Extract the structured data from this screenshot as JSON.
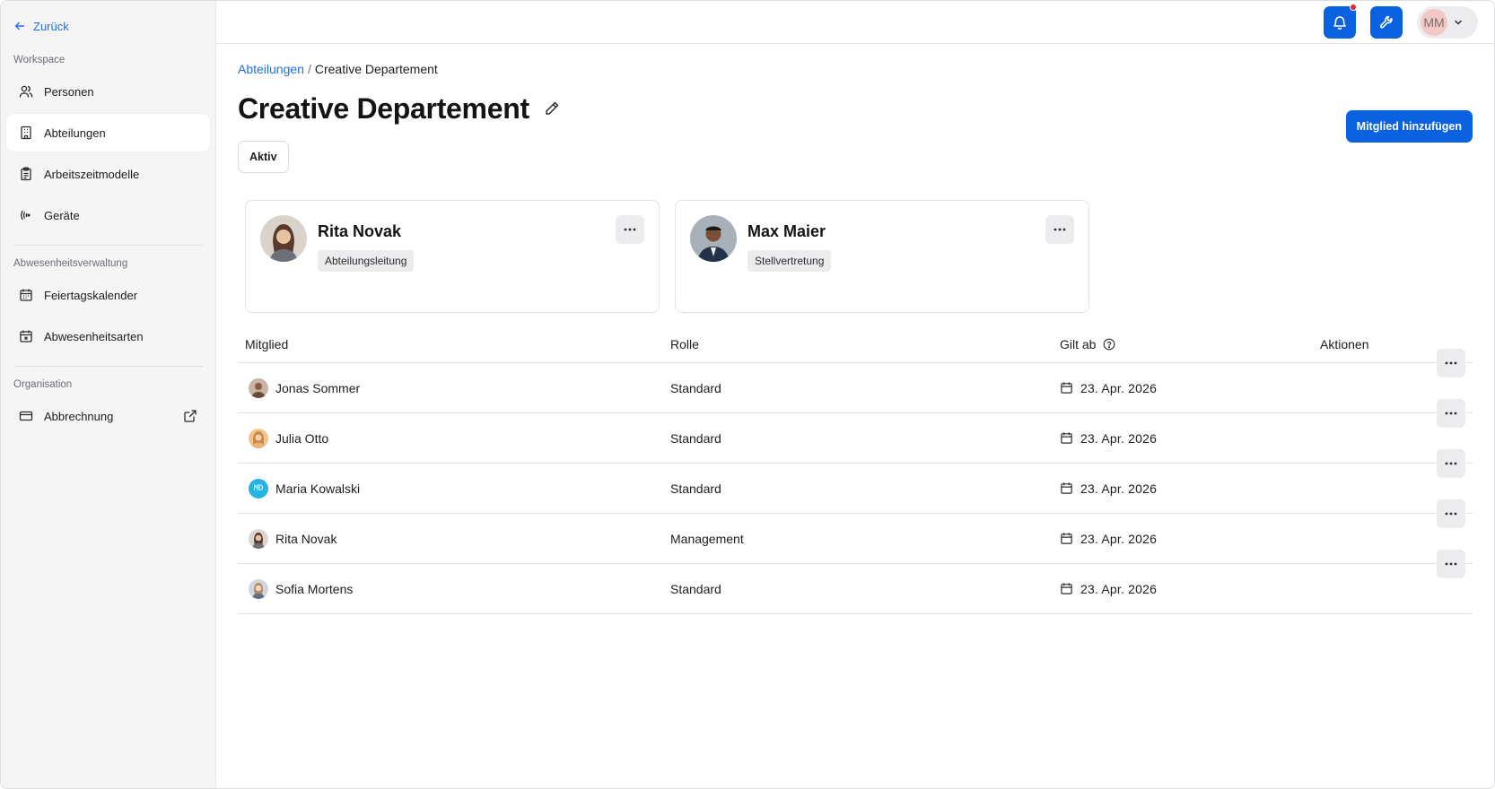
{
  "sidebar": {
    "back_label": "Zurück",
    "sections": [
      {
        "label": "Workspace"
      },
      {
        "label": "Abwesenheitsverwaltung"
      },
      {
        "label": "Organisation"
      }
    ],
    "items": [
      {
        "label": "Personen",
        "icon": "users-icon"
      },
      {
        "label": "Abteilungen",
        "icon": "building-icon",
        "active": true
      },
      {
        "label": "Arbeitszeitmodelle",
        "icon": "clipboard-icon"
      },
      {
        "label": "Geräte",
        "icon": "signal-icon"
      },
      {
        "label": "Feiertagskalender",
        "icon": "calendar-icon"
      },
      {
        "label": "Abwesenheitsarten",
        "icon": "calendar-x-icon"
      },
      {
        "label": "Abbrechnung",
        "icon": "credit-card-icon",
        "external": true
      }
    ]
  },
  "topbar": {
    "user_initials": "MM",
    "notification_icon": "bell-icon",
    "tools_icon": "wrench-icon"
  },
  "breadcrumb": {
    "parent": "Abteilungen",
    "separator": "/",
    "current": "Creative Departement"
  },
  "page": {
    "title": "Creative Departement",
    "status": "Aktiv",
    "add_member_label": "Mitglied hinzufügen"
  },
  "leaders": [
    {
      "name": "Rita Novak",
      "role": "Abteilungsleitung"
    },
    {
      "name": "Max Maier",
      "role": "Stellvertretung"
    }
  ],
  "table": {
    "headers": {
      "member": "Mitglied",
      "role": "Rolle",
      "valid_from": "Gilt ab",
      "actions": "Aktionen"
    },
    "rows": [
      {
        "name": "Jonas Sommer",
        "role": "Standard",
        "date": "23. Apr. 2026"
      },
      {
        "name": "Julia Otto",
        "role": "Standard",
        "date": "23. Apr. 2026"
      },
      {
        "name": "Maria Kowalski",
        "role": "Standard",
        "date": "23. Apr. 2026",
        "initials": "MD"
      },
      {
        "name": "Rita Novak",
        "role": "Management",
        "date": "23. Apr. 2026"
      },
      {
        "name": "Sofia Mortens",
        "role": "Standard",
        "date": "23. Apr. 2026"
      }
    ]
  },
  "colors": {
    "accent": "#0b62e0",
    "link": "#1f6feb",
    "notification": "#e5262e"
  }
}
